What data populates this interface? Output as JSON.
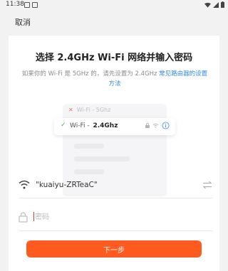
{
  "status_bar": {
    "time": "11:38"
  },
  "nav": {
    "cancel_label": "取消"
  },
  "main": {
    "title": "选择 2.4GHz Wi-Fi 网络并输入密码",
    "subtitle_prefix": "如果你的 Wi-Fi 是 5GHz 的，请先设置为 2.4GHz ",
    "subtitle_link": "常见路由器的设置方法"
  },
  "illustration": {
    "bad_network": {
      "name": "Wi-Fi - ",
      "band": "5Ghz"
    },
    "good_network": {
      "name": "Wi-Fi - ",
      "band": "2.4Ghz"
    }
  },
  "form": {
    "ssid_value": "\"kuaiyu-ZRTeaC\"",
    "password_placeholder": "密码",
    "password_value": ""
  },
  "actions": {
    "next_label": "下一步"
  },
  "colors": {
    "accent": "#ff5a1f",
    "link": "#2f89f5",
    "ok": "#4caf50",
    "error": "#f26b6b"
  }
}
